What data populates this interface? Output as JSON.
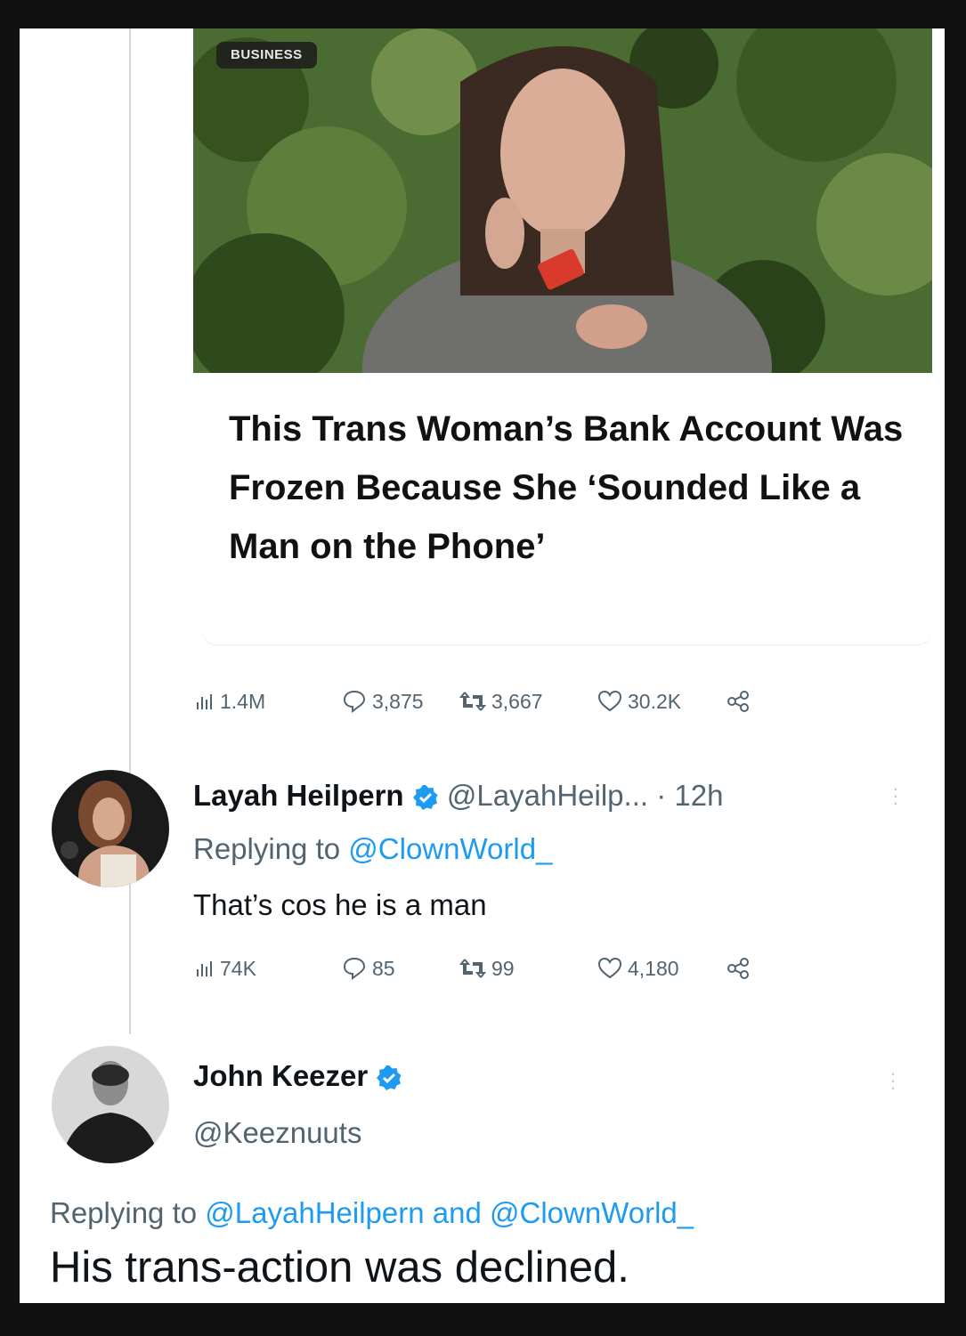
{
  "article": {
    "badge": "BUSINESS",
    "headline": "This Trans Woman’s Bank Account Was Frozen Because She ‘Sounded Like a Man on the Phone’"
  },
  "main_stats": {
    "views": "1.4M",
    "replies": "3,875",
    "retweets": "3,667",
    "likes": "30.2K"
  },
  "reply1": {
    "name": "Layah Heilpern",
    "handle": "@LayahHeilp...",
    "time": "· 12h",
    "replying_prefix": "Replying to",
    "replying_to": "@ClownWorld_",
    "text": "That’s cos he is a man",
    "stats": {
      "views": "74K",
      "replies": "85",
      "retweets": "99",
      "likes": "4,180"
    }
  },
  "reply2": {
    "name": "John Keezer",
    "handle": "@Keeznuuts",
    "replying_prefix": "Replying to",
    "replying_to_1": "@LayahHeilpern",
    "replying_and": "and",
    "replying_to_2": "@ClownWorld_",
    "text": "His trans-action was declined."
  },
  "colors": {
    "verified": "#1d9bf0",
    "link": "#1d9bf0",
    "muted": "#536471"
  },
  "icons": [
    "views-icon",
    "reply-icon",
    "retweet-icon",
    "like-icon",
    "share-icon",
    "verified-badge-icon",
    "more-icon"
  ]
}
